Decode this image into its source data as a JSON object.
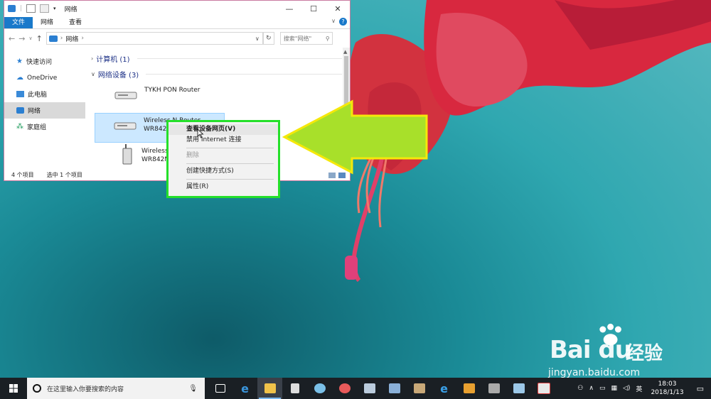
{
  "window": {
    "title": "网络",
    "controls": [
      "—",
      "☐",
      "✕"
    ],
    "ribbon_tabs": [
      "文件",
      "网络",
      "查看"
    ],
    "address_path": "网络",
    "search_placeholder": "搜索\"网络\""
  },
  "sidebar": {
    "items": [
      {
        "label": "快速访问",
        "icon": "star-icon"
      },
      {
        "label": "OneDrive",
        "icon": "cloud-icon"
      },
      {
        "label": "此电脑",
        "icon": "computer-icon"
      },
      {
        "label": "网络",
        "icon": "network-icon",
        "selected": true
      },
      {
        "label": "家庭组",
        "icon": "homegroup-icon"
      }
    ]
  },
  "content": {
    "group_computers": "计算机 (1)",
    "group_network_devices": "网络设备 (3)",
    "devices": [
      {
        "line1": "TYKH PON Router",
        "line2": ""
      },
      {
        "line1": "Wireless N Router",
        "line2": "WR842N"
      },
      {
        "line1": "Wireless",
        "line2": "WR842N"
      }
    ]
  },
  "status_bar": {
    "item_count": "4 个项目",
    "selected_count": "选中 1 个项目"
  },
  "context_menu": {
    "items": [
      {
        "label": "查看设备网页(V)",
        "bold": true
      },
      {
        "label": "禁用 Internet 连接"
      },
      {
        "label": "删除",
        "disabled": true
      },
      {
        "label": "创建快捷方式(S)"
      },
      {
        "label": "属性(R)"
      }
    ]
  },
  "taskbar": {
    "search_placeholder": "在这里输入你要搜索的内容",
    "tray_lang": "英",
    "time": "18:03",
    "date": "2018/1/13"
  },
  "watermark": {
    "brand": "Bai du",
    "cn": "经验",
    "url": "jingyan.baidu.com"
  },
  "colors": {
    "highlight_green": "#25e02a",
    "arrow_fill": "#a8e02a",
    "arrow_stroke": "#f5e80a",
    "file_tab": "#1979ca",
    "taskbar": "#1a1f24"
  }
}
